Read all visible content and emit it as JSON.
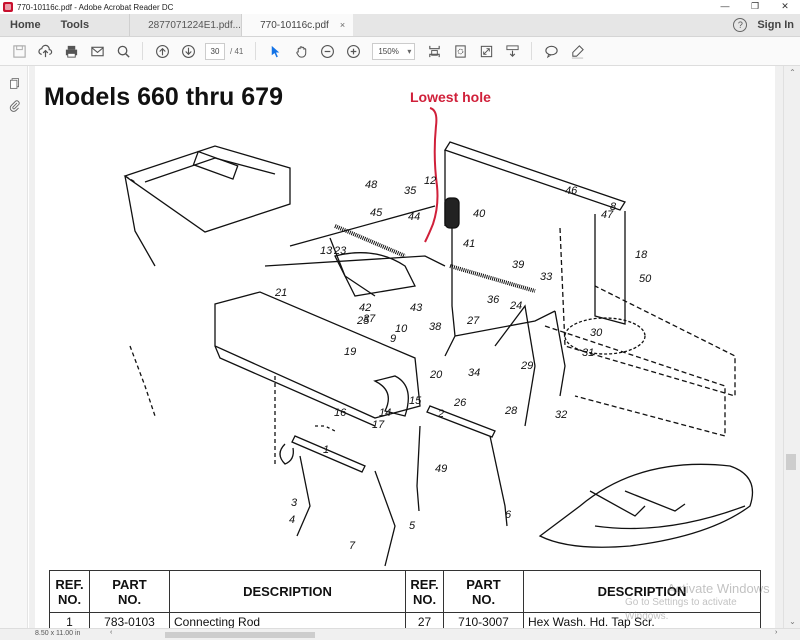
{
  "window": {
    "title": "770-10116c.pdf - Adobe Acrobat Reader DC",
    "controls": {
      "minimize": "—",
      "restore": "❐",
      "close": "✕"
    }
  },
  "tabs": {
    "home": "Home",
    "tools": "Tools",
    "documents": [
      {
        "label": "2877071224E1.pdf...",
        "active": false
      },
      {
        "label": "770-10116c.pdf",
        "active": true,
        "close": "×"
      }
    ],
    "help": "?",
    "sign_in": "Sign In"
  },
  "toolbar": {
    "icons": [
      "save-icon",
      "upload-cloud-icon",
      "print-icon",
      "email-icon",
      "search-icon",
      "prev-page-icon",
      "next-page-icon",
      "select-cursor-icon",
      "hand-tool-icon",
      "zoom-out-icon",
      "zoom-in-icon",
      "fit-page-icon",
      "rotate-icon",
      "fullscreen-icon",
      "scroll-mode-icon",
      "comment-icon",
      "highlight-pen-icon"
    ],
    "current_page": "30",
    "total_pages": "/ 41",
    "zoom_level": "150%",
    "accent_color": "#1473e6"
  },
  "left_panel": {
    "icons": [
      "page-thumbnails-icon",
      "attachments-icon"
    ]
  },
  "document": {
    "page_title": "Models 660 thru 679",
    "annotation": "Lowest hole",
    "annotation_color": "#d0203a",
    "diagram_labels": [
      "1",
      "2",
      "3",
      "4",
      "5",
      "6",
      "7",
      "8",
      "9",
      "10",
      "12",
      "13",
      "14",
      "15",
      "16",
      "17",
      "18",
      "19",
      "20",
      "21",
      "23",
      "24",
      "25",
      "26",
      "27",
      "28",
      "29",
      "30",
      "31",
      "32",
      "33",
      "34",
      "35",
      "36",
      "37",
      "38",
      "39",
      "40",
      "41",
      "42",
      "43",
      "44",
      "45",
      "46",
      "47",
      "48",
      "49",
      "50"
    ],
    "table": {
      "headers": [
        {
          "l1": "REF.",
          "l2": "NO."
        },
        {
          "l1": "PART",
          "l2": "NO."
        },
        {
          "l1": "DESCRIPTION",
          "l2": ""
        },
        {
          "l1": "REF.",
          "l2": "NO."
        },
        {
          "l1": "PART",
          "l2": "NO."
        },
        {
          "l1": "DESCRIPTION",
          "l2": ""
        }
      ],
      "rows": [
        {
          "ref1": "1",
          "part1": "783-0103",
          "desc1": "Connecting Rod",
          "ref2": "27",
          "part2": "710-3007",
          "desc2": "Hex Wash. Hd. Tap Scr."
        }
      ]
    }
  },
  "status": {
    "page_size": "8.50 x 11.00 in"
  },
  "watermark": {
    "line1": "Activate Windows",
    "line2": "Go to Settings to activate Windows."
  }
}
